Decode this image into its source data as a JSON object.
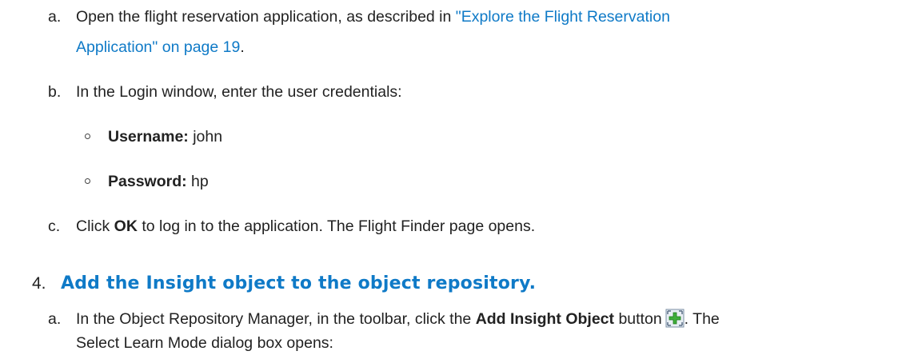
{
  "steps": {
    "a": {
      "marker": "a.",
      "text": "Open the flight reservation application, as described in ",
      "link_line1": "\"Explore the Flight Reservation",
      "link_line2": "Application\" on page 19",
      "end": "."
    },
    "b": {
      "marker": "b.",
      "text": "In the Login window, enter the user credentials:",
      "credentials": [
        {
          "label": "Username:",
          "value": " john"
        },
        {
          "label": "Password:",
          "value": " hp"
        }
      ]
    },
    "c": {
      "marker": "c.",
      "pre": "Click ",
      "bold": "OK",
      "post": " to log in to the application. The Flight Finder page opens."
    }
  },
  "step4": {
    "number": "4.",
    "title": "Add the Insight object to the object repository.",
    "a": {
      "marker": "a.",
      "pre": "In the Object Repository Manager, in the toolbar, click the ",
      "bold": "Add Insight Object",
      "post": " button",
      "icon": "add-insight-object-icon",
      "after_icon": ". The",
      "line2": "Select Learn Mode dialog box opens:"
    }
  },
  "colors": {
    "link": "#0f7ac7",
    "text": "#222222"
  }
}
